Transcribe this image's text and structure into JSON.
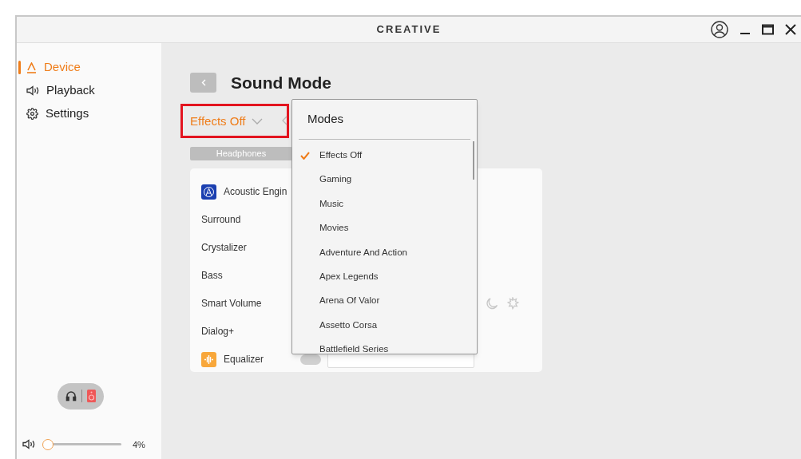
{
  "title_bar": {
    "logo": "CREATIVE"
  },
  "sidebar": {
    "items": [
      {
        "label": "Device",
        "kind": "device",
        "selected": true
      },
      {
        "label": "Playback",
        "kind": "speaker",
        "selected": false
      },
      {
        "label": "Settings",
        "kind": "gear",
        "selected": false
      }
    ]
  },
  "output_devices": [
    {
      "kind": "headphones",
      "selected": false
    },
    {
      "kind": "speaker",
      "selected": true
    }
  ],
  "volume": {
    "level": 0.04,
    "reading": "4%"
  },
  "page": {
    "title": "Sound Mode",
    "mode_value": "Effects Off",
    "highlighted": true,
    "tabs": [
      {
        "label": "Headphones",
        "selected": true
      }
    ],
    "rows": [
      {
        "kind": "header",
        "label": "Acoustic Engin"
      },
      {
        "kind": "plain",
        "label": "Surround"
      },
      {
        "kind": "plain",
        "label": "Crystalizer"
      },
      {
        "kind": "plain",
        "label": "Bass"
      },
      {
        "kind": "night",
        "label": "Smart Volume"
      },
      {
        "kind": "plain",
        "label": "Dialog+"
      },
      {
        "kind": "equalizer",
        "label": "Equalizer",
        "on": false
      }
    ]
  },
  "dropdown": {
    "title": "Modes",
    "items": [
      {
        "label": "Effects Off",
        "selected": true
      },
      {
        "label": "Gaming",
        "selected": false
      },
      {
        "label": "Music",
        "selected": false
      },
      {
        "label": "Movies",
        "selected": false
      },
      {
        "label": "Adventure And Action",
        "selected": false
      },
      {
        "label": "Apex Legends",
        "selected": false
      },
      {
        "label": "Arena Of Valor",
        "selected": false
      },
      {
        "label": "Assetto Corsa",
        "selected": false
      },
      {
        "label": "Battlefield Series",
        "selected": false
      }
    ]
  }
}
